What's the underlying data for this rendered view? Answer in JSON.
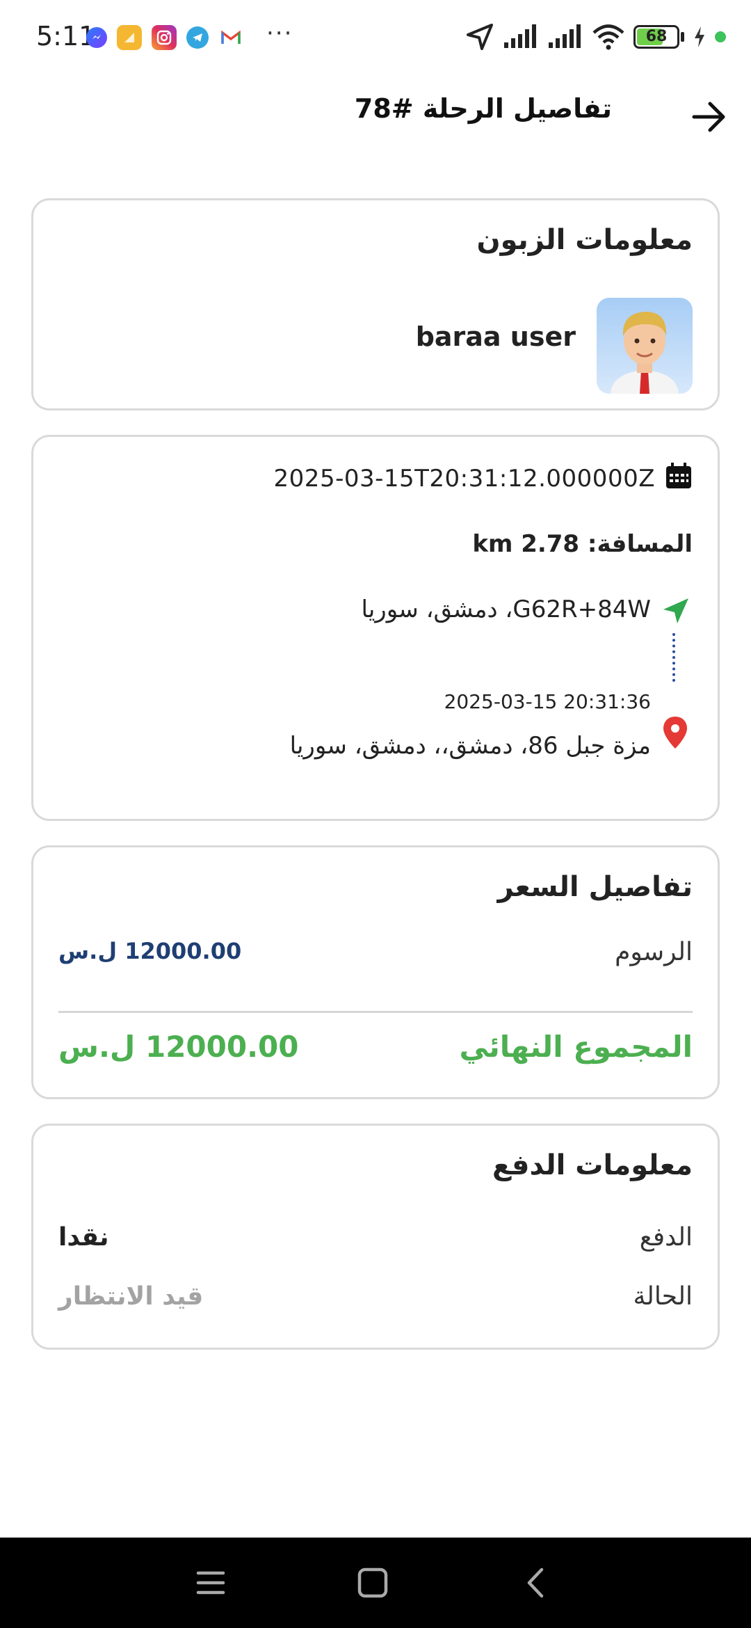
{
  "status_bar": {
    "time": "5:11",
    "more": "···",
    "battery": "68",
    "battery_fraction": 0.68,
    "app_icons": [
      "messenger-icon",
      "notes-app-icon",
      "instagram-icon",
      "telegram-icon",
      "gmail-icon"
    ],
    "system_icons": [
      "location-arrow-icon",
      "signal-icon",
      "signal-icon",
      "wifi-icon",
      "battery-icon",
      "charging-icon"
    ]
  },
  "header": {
    "title": "تفاصيل الرحلة #78",
    "back_icon": "arrow-right-icon"
  },
  "customer": {
    "title": "معلومات الزبون",
    "name": "baraa user"
  },
  "trip": {
    "date": "2025-03-15T20:31:12.000000Z",
    "distance": "المسافة: km 2.78",
    "pickup": "G62R+84W، دمشق، سوريا",
    "dropoff_time": "2025-03-15 20:31:36",
    "dropoff": "مزة جبل 86، دمشق،، دمشق، سوريا"
  },
  "pricing": {
    "title": "تفاصيل السعر",
    "fees_label": "الرسوم",
    "fees_value": "12000.00 ل.س",
    "total_label": "المجموع النهائي",
    "total_value": "12000.00 ل.س"
  },
  "payment": {
    "title": "معلومات الدفع",
    "method_label": "الدفع",
    "method_value": "نقدا",
    "status_label": "الحالة",
    "status_value": "قيد الانتظار"
  },
  "colors": {
    "accent_green": "#4caf50",
    "fees_blue": "#1f3f73",
    "pending_gray": "#a3a3a3",
    "pin_red": "#e53935"
  },
  "nav": {
    "icons": [
      "menu-icon",
      "home-icon",
      "back-icon"
    ]
  }
}
